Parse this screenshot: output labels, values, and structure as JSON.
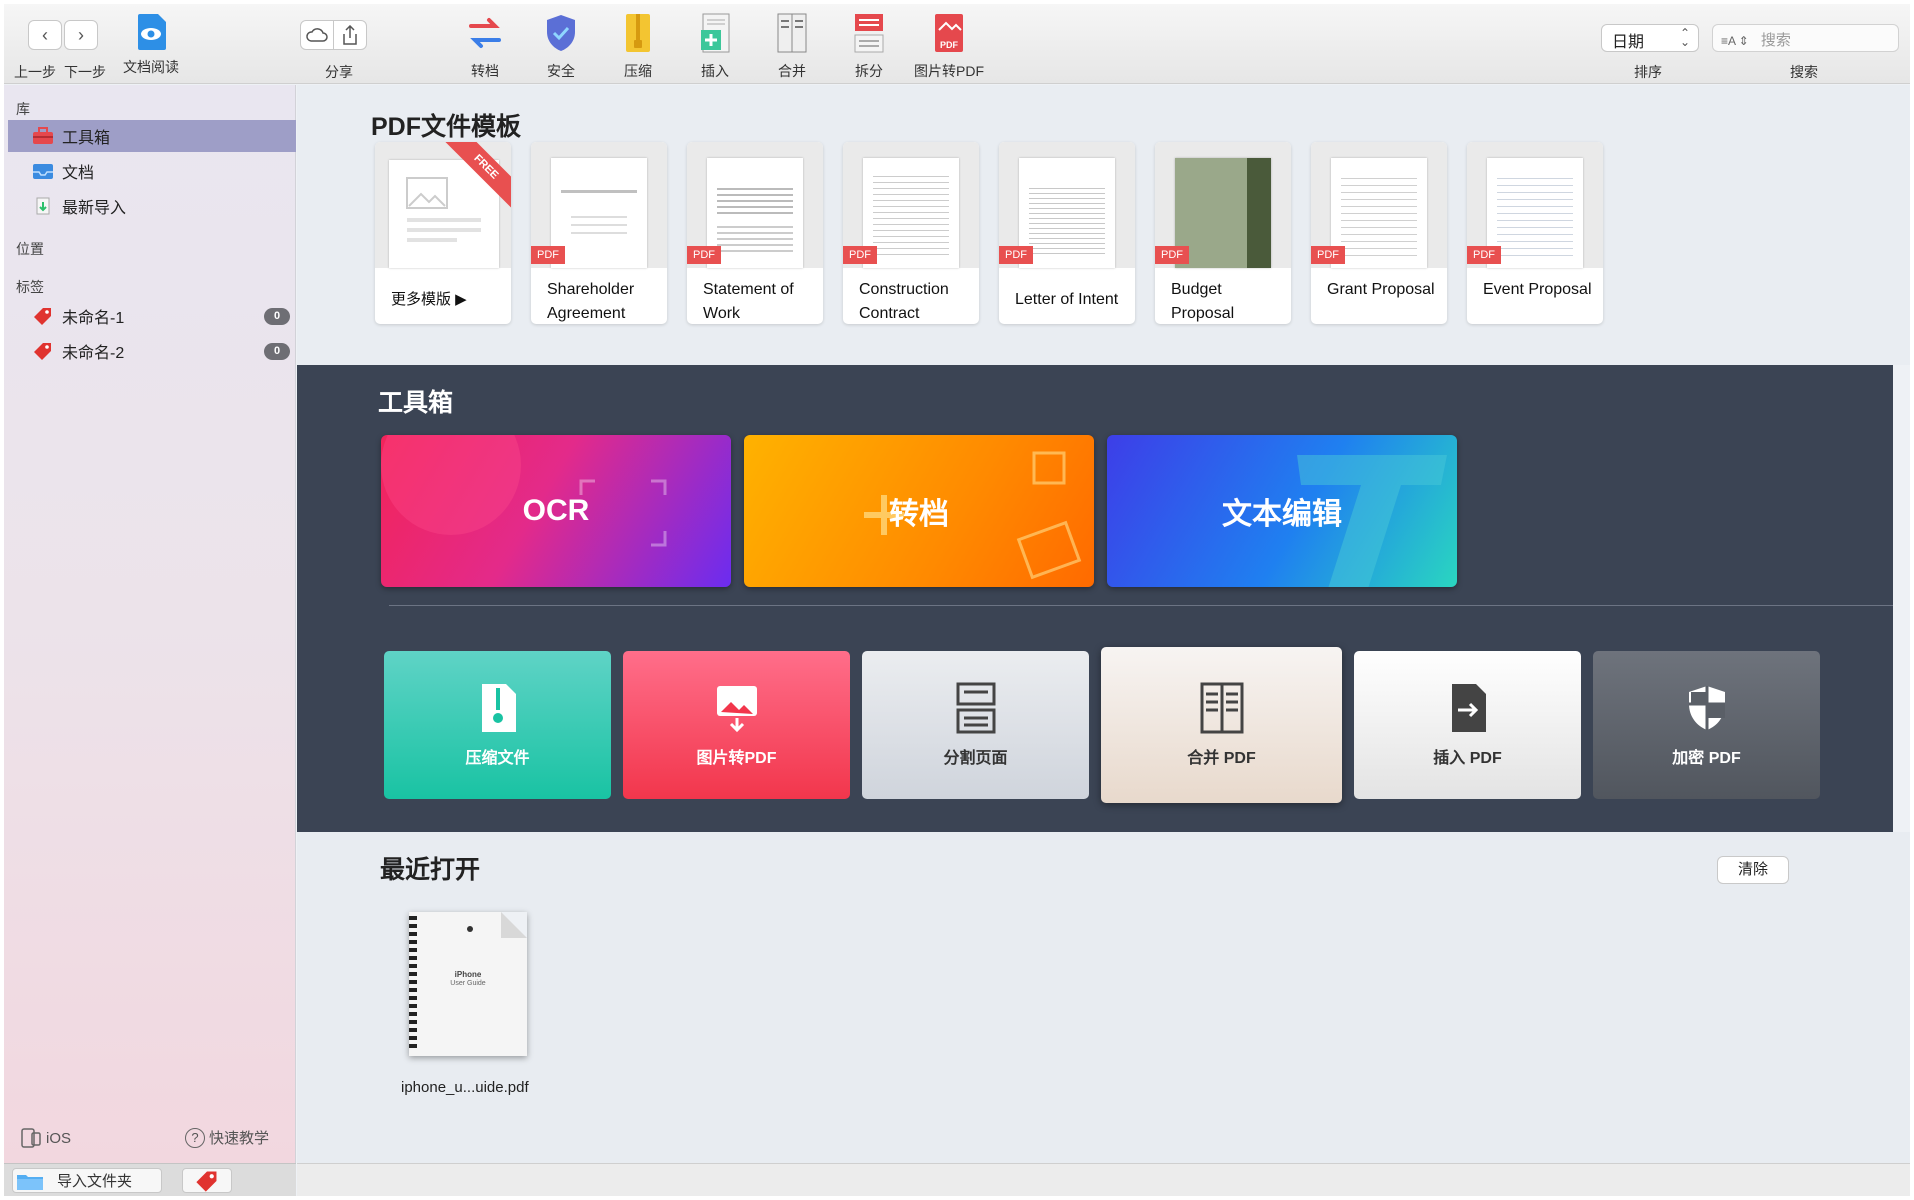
{
  "toolbar": {
    "back_label": "上一步",
    "forward_label": "下一步",
    "reader_label": "文档阅读",
    "share_label": "分享",
    "tools": [
      {
        "name": "convert",
        "label": "转档"
      },
      {
        "name": "security",
        "label": "安全"
      },
      {
        "name": "compress",
        "label": "压缩"
      },
      {
        "name": "insert",
        "label": "插入"
      },
      {
        "name": "merge",
        "label": "合并"
      },
      {
        "name": "split",
        "label": "拆分"
      },
      {
        "name": "image-to-pdf",
        "label": "图片转PDF"
      }
    ],
    "sort_value": "日期",
    "sort_label": "排序",
    "search_placeholder": "搜索",
    "search_label": "搜索"
  },
  "sidebar": {
    "library_title": "库",
    "library_items": [
      {
        "label": "工具箱",
        "icon": "toolbox-icon"
      },
      {
        "label": "文档",
        "icon": "inbox-icon"
      },
      {
        "label": "最新导入",
        "icon": "import-icon"
      }
    ],
    "location_title": "位置",
    "tags_title": "标签",
    "tags": [
      {
        "label": "未命名-1",
        "count": "0"
      },
      {
        "label": "未命名-2",
        "count": "0"
      }
    ],
    "ios_label": "iOS",
    "tutorial_label": "快速教学",
    "import_folder_label": "导入文件夹"
  },
  "templates": {
    "title": "PDF文件模板",
    "more_label": "更多模版 ▶",
    "free_badge": "FREE",
    "pdf_tag": "PDF",
    "items": [
      {
        "label": "Shareholder Agreement"
      },
      {
        "label": "Statement of Work"
      },
      {
        "label": "Construction Contract"
      },
      {
        "label": "Letter of Intent"
      },
      {
        "label": "Budget Proposal"
      },
      {
        "label": "Grant Proposal"
      },
      {
        "label": "Event Proposal"
      }
    ]
  },
  "toolbox": {
    "title": "工具箱",
    "big_tools": [
      {
        "label": "OCR"
      },
      {
        "label": "转档"
      },
      {
        "label": "文本编辑"
      }
    ],
    "small_tools": [
      {
        "label": "压缩文件"
      },
      {
        "label": "图片转PDF"
      },
      {
        "label": "分割页面"
      },
      {
        "label": "合并 PDF"
      },
      {
        "label": "插入 PDF"
      },
      {
        "label": "加密 PDF"
      }
    ]
  },
  "recent": {
    "title": "最近打开",
    "clear_label": "清除",
    "files": [
      {
        "name": "iphone_u...uide.pdf",
        "thumb_title": "iPhone",
        "thumb_subtitle": "User Guide"
      }
    ]
  }
}
